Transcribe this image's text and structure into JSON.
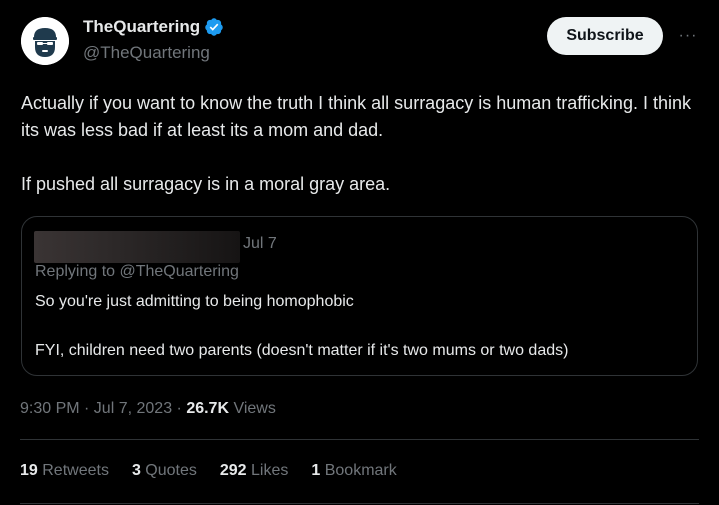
{
  "author": {
    "display_name": "TheQuartering",
    "handle": "@TheQuartering",
    "avatar_icon": "bearded-face-icon",
    "verified_icon": "verified-badge-icon"
  },
  "actions": {
    "subscribe_label": "Subscribe",
    "more_label": "···"
  },
  "tweet": {
    "paragraphs": [
      "Actually if you want to know the truth I think all surragacy is human trafficking. I think its was less bad if at least its a mom and dad.",
      "If pushed all surragacy is in a moral gray area."
    ]
  },
  "quote": {
    "date": "Jul 7",
    "replying_to": "Replying to @TheQuartering",
    "lines": [
      "So you're just admitting to being homophobic",
      "FYI, children need two parents (doesn't matter if it's two mums or two dads)"
    ]
  },
  "meta": {
    "time": "9:30 PM · Jul 7, 2023 · ",
    "views_count": "26.7K",
    "views_label": " Views"
  },
  "stats": [
    {
      "count": "19",
      "label": " Retweets"
    },
    {
      "count": "3",
      "label": " Quotes"
    },
    {
      "count": "292",
      "label": " Likes"
    },
    {
      "count": "1",
      "label": " Bookmark"
    }
  ],
  "colors": {
    "background": "#000000",
    "text": "#e7e9ea",
    "muted": "#71767b",
    "verified": "#1d9bf0",
    "border": "#2f3336",
    "button_bg": "#eff3f4"
  }
}
